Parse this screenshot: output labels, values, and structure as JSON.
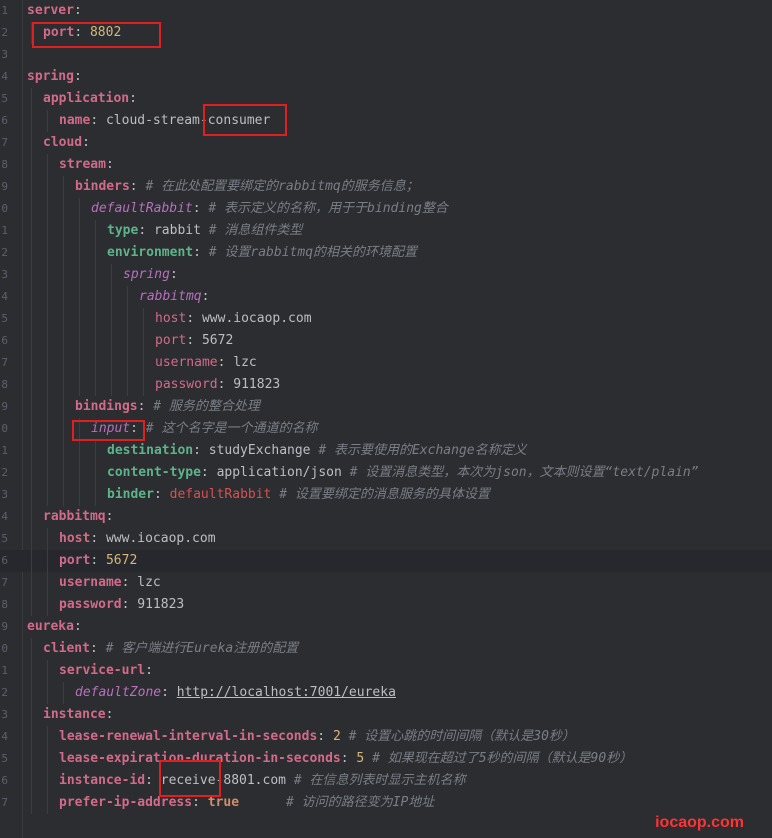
{
  "lines": [
    {
      "no": "1",
      "indent": 0,
      "key": "server",
      "keyStyle": "key",
      "sep": ":",
      "value": "",
      "comment": ""
    },
    {
      "no": "2",
      "indent": 1,
      "key": "port",
      "keyStyle": "key",
      "sep": ":",
      "value": "8802",
      "valueStyle": "num",
      "comment": ""
    },
    {
      "no": "3",
      "indent": 0,
      "key": "",
      "sep": "",
      "value": "",
      "comment": ""
    },
    {
      "no": "4",
      "indent": 0,
      "key": "spring",
      "keyStyle": "key",
      "sep": ":",
      "value": "",
      "comment": ""
    },
    {
      "no": "5",
      "indent": 1,
      "key": "application",
      "keyStyle": "key",
      "sep": ":",
      "value": "",
      "comment": ""
    },
    {
      "no": "6",
      "indent": 2,
      "key": "name",
      "keyStyle": "key",
      "sep": ":",
      "value": "cloud-stream-consumer",
      "valueStyle": "v",
      "comment": ""
    },
    {
      "no": "7",
      "indent": 1,
      "key": "cloud",
      "keyStyle": "key",
      "sep": ":",
      "value": "",
      "comment": ""
    },
    {
      "no": "8",
      "indent": 2,
      "key": "stream",
      "keyStyle": "key",
      "sep": ":",
      "value": "",
      "comment": ""
    },
    {
      "no": "9",
      "indent": 3,
      "key": "binders",
      "keyStyle": "key",
      "sep": ":",
      "value": "",
      "comment": "# 在此处配置要绑定的rabbitmq的服务信息；"
    },
    {
      "no": "0",
      "indent": 4,
      "key": "defaultRabbit",
      "keyStyle": "keyi",
      "sep": ":",
      "value": "",
      "comment": "# 表示定义的名称，用于于binding整合"
    },
    {
      "no": "1",
      "indent": 5,
      "key": "type",
      "keyStyle": "keyg",
      "sep": ":",
      "value": "rabbit",
      "valueStyle": "v",
      "comment": "# 消息组件类型"
    },
    {
      "no": "2",
      "indent": 5,
      "key": "environment",
      "keyStyle": "keyg",
      "sep": ":",
      "value": "",
      "comment": "# 设置rabbitmq的相关的环境配置"
    },
    {
      "no": "3",
      "indent": 6,
      "key": "spring",
      "keyStyle": "keyi",
      "sep": ":",
      "value": "",
      "comment": ""
    },
    {
      "no": "4",
      "indent": 7,
      "key": "rabbitmq",
      "keyStyle": "keyi",
      "sep": ":",
      "value": "",
      "comment": ""
    },
    {
      "no": "5",
      "indent": 8,
      "key": "host",
      "keyStyle": "k2",
      "sep": ":",
      "value": "www.iocaop.com",
      "valueStyle": "v",
      "comment": ""
    },
    {
      "no": "6",
      "indent": 8,
      "key": "port",
      "keyStyle": "k2",
      "sep": ":",
      "value": "5672",
      "valueStyle": "v",
      "comment": ""
    },
    {
      "no": "7",
      "indent": 8,
      "key": "username",
      "keyStyle": "k2",
      "sep": ":",
      "value": "lzc",
      "valueStyle": "v",
      "comment": ""
    },
    {
      "no": "8",
      "indent": 8,
      "key": "password",
      "keyStyle": "k2",
      "sep": ":",
      "value": "911823",
      "valueStyle": "v",
      "comment": ""
    },
    {
      "no": "9",
      "indent": 3,
      "key": "bindings",
      "keyStyle": "key",
      "sep": ":",
      "value": "",
      "comment": "# 服务的整合处理"
    },
    {
      "no": "0",
      "indent": 4,
      "key": "input",
      "keyStyle": "keyi",
      "sep": ":",
      "value": "",
      "comment": "# 这个名字是一个通道的名称"
    },
    {
      "no": "1",
      "indent": 5,
      "key": "destination",
      "keyStyle": "keyg",
      "sep": ":",
      "value": "studyExchange",
      "valueStyle": "v",
      "comment": "# 表示要使用的Exchange名称定义"
    },
    {
      "no": "2",
      "indent": 5,
      "key": "content-type",
      "keyStyle": "keyg",
      "sep": ":",
      "value": "application/json",
      "valueStyle": "v",
      "comment": "# 设置消息类型，本次为json，文本则设置“text/plain”"
    },
    {
      "no": "3",
      "indent": 5,
      "key": "binder",
      "keyStyle": "keyg",
      "sep": ":",
      "value": "defaultRabbit",
      "valueStyle": "redref",
      "comment": "# 设置要绑定的消息服务的具体设置"
    },
    {
      "no": "4",
      "indent": 1,
      "key": "rabbitmq",
      "keyStyle": "key",
      "sep": ":",
      "value": "",
      "comment": ""
    },
    {
      "no": "5",
      "indent": 2,
      "key": "host",
      "keyStyle": "key",
      "sep": ":",
      "value": "www.iocaop.com",
      "valueStyle": "v",
      "comment": ""
    },
    {
      "no": "6",
      "indent": 2,
      "key": "port",
      "keyStyle": "key",
      "sep": ":",
      "value": "5672",
      "valueStyle": "num",
      "comment": "",
      "current": true
    },
    {
      "no": "7",
      "indent": 2,
      "key": "username",
      "keyStyle": "key",
      "sep": ":",
      "value": "lzc",
      "valueStyle": "v",
      "comment": ""
    },
    {
      "no": "8",
      "indent": 2,
      "key": "password",
      "keyStyle": "key",
      "sep": ":",
      "value": "911823",
      "valueStyle": "v",
      "comment": ""
    },
    {
      "no": "9",
      "indent": 0,
      "key": "eureka",
      "keyStyle": "key",
      "sep": ":",
      "value": "",
      "comment": ""
    },
    {
      "no": "0",
      "indent": 1,
      "key": "client",
      "keyStyle": "key",
      "sep": ":",
      "value": "",
      "comment": "# 客户端进行Eureka注册的配置"
    },
    {
      "no": "1",
      "indent": 2,
      "key": "service-url",
      "keyStyle": "key",
      "sep": ":",
      "value": "",
      "comment": ""
    },
    {
      "no": "2",
      "indent": 3,
      "key": "defaultZone",
      "keyStyle": "keyi",
      "sep": ":",
      "value": "http://localhost:7001/eureka",
      "valueStyle": "url",
      "comment": ""
    },
    {
      "no": "3",
      "indent": 1,
      "key": "instance",
      "keyStyle": "key",
      "sep": ":",
      "value": "",
      "comment": ""
    },
    {
      "no": "4",
      "indent": 2,
      "key": "lease-renewal-interval-in-seconds",
      "keyStyle": "key",
      "sep": ":",
      "value": "2",
      "valueStyle": "num",
      "comment": "# 设置心跳的时间间隔（默认是30秒）"
    },
    {
      "no": "5",
      "indent": 2,
      "key": "lease-expiration-duration-in-seconds",
      "keyStyle": "key",
      "sep": ":",
      "value": "5",
      "valueStyle": "num",
      "comment": "# 如果现在超过了5秒的间隔（默认是90秒）"
    },
    {
      "no": "6",
      "indent": 2,
      "key": "instance-id",
      "keyStyle": "key",
      "sep": ":",
      "value": "receive-8801.com",
      "valueStyle": "v",
      "comment": "# 在信息列表时显示主机名称"
    },
    {
      "no": "7",
      "indent": 2,
      "key": "prefer-ip-address",
      "keyStyle": "key",
      "sep": ":",
      "value": "true",
      "valueStyle": "boolv",
      "comment": "     # 访问的路径变为IP地址"
    }
  ],
  "watermark": "iocaop.com"
}
